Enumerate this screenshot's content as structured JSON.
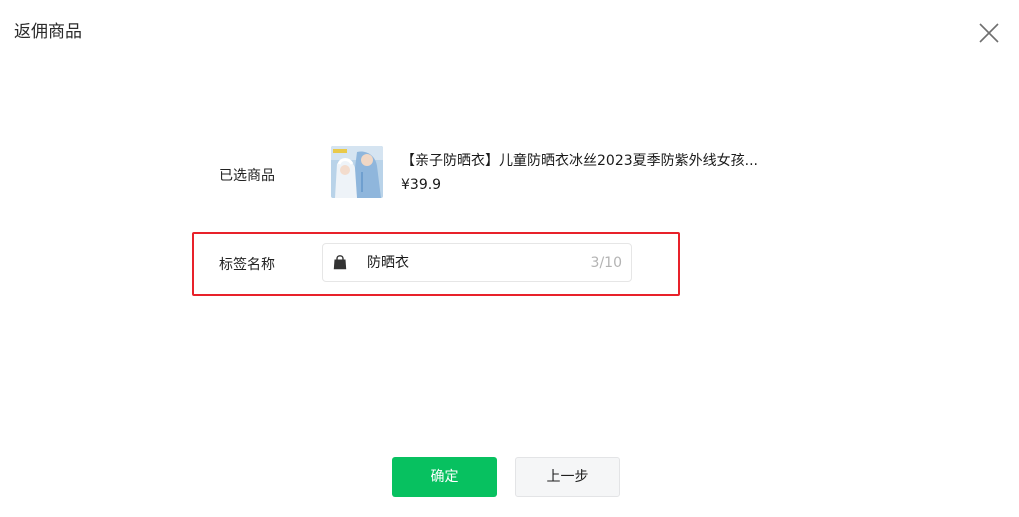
{
  "dialog": {
    "title": "返佣商品"
  },
  "selected_product": {
    "label": "已选商品",
    "name": "【亲子防晒衣】儿童防晒衣冰丝2023夏季防紫外线女孩...",
    "price": "¥39.9",
    "thumbnail_icon": "product-photo"
  },
  "tag_name": {
    "label": "标签名称",
    "value": "防晒衣",
    "counter": "3/10",
    "icon": "shopping-bag-icon"
  },
  "buttons": {
    "confirm": "确定",
    "previous": "上一步"
  },
  "colors": {
    "primary": "#07c160",
    "highlight": "#e8212a"
  }
}
